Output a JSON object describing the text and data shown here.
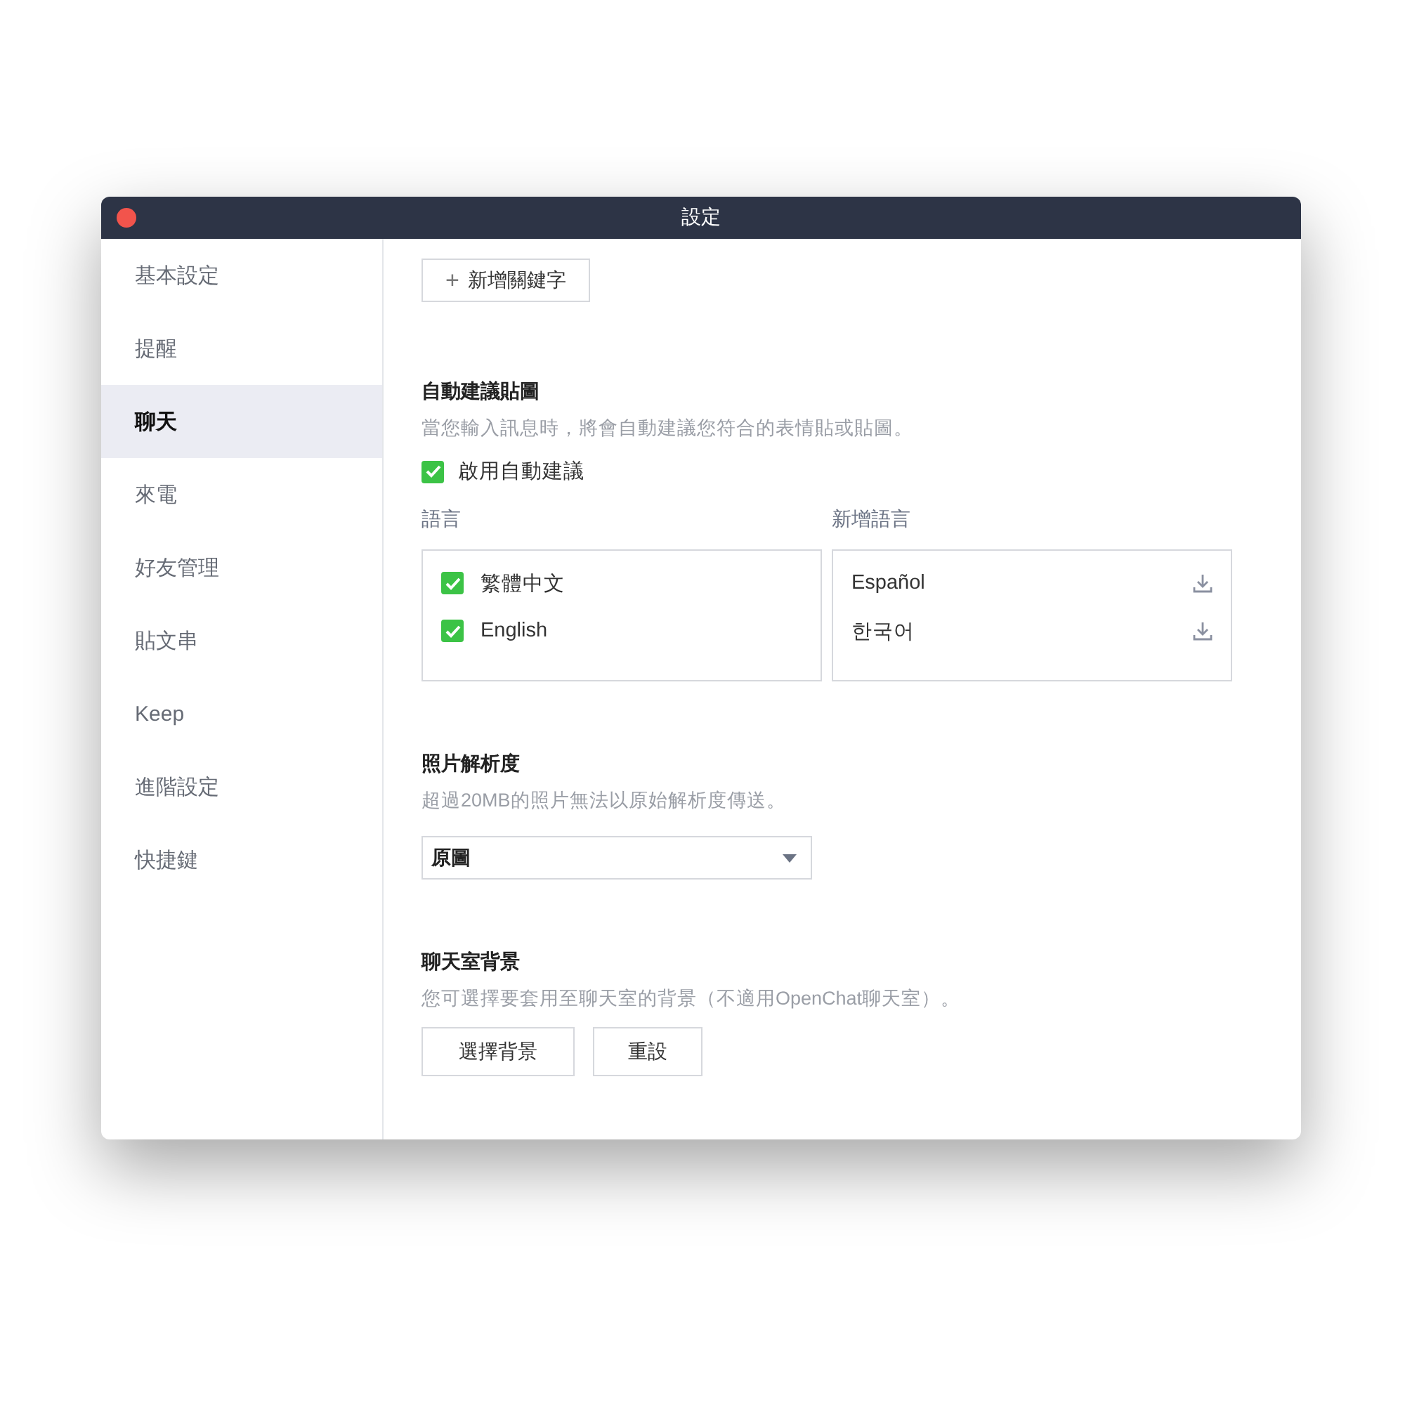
{
  "window": {
    "title": "設定"
  },
  "sidebar": {
    "items": [
      {
        "label": "基本設定",
        "selected": false
      },
      {
        "label": "提醒",
        "selected": false
      },
      {
        "label": "聊天",
        "selected": true
      },
      {
        "label": "來電",
        "selected": false
      },
      {
        "label": "好友管理",
        "selected": false
      },
      {
        "label": "貼文串",
        "selected": false
      },
      {
        "label": "Keep",
        "selected": false
      },
      {
        "label": "進階設定",
        "selected": false
      },
      {
        "label": "快捷鍵",
        "selected": false
      }
    ]
  },
  "add_keyword_button": {
    "icon": "+",
    "label": "新增關鍵字"
  },
  "sticker_suggestions": {
    "title": "自動建議貼圖",
    "description": "當您輸入訊息時，將會自動建議您符合的表情貼或貼圖。",
    "enable": {
      "label": "啟用自動建議",
      "checked": true
    },
    "languages_label": "語言",
    "languages": [
      {
        "label": "繁體中文",
        "checked": true
      },
      {
        "label": "English",
        "checked": true
      }
    ],
    "add_languages_label": "新增語言",
    "add_languages": [
      {
        "label": "Español"
      },
      {
        "label": "한국어"
      }
    ]
  },
  "photo_resolution": {
    "title": "照片解析度",
    "description": "超過20MB的照片無法以原始解析度傳送。",
    "value": "原圖"
  },
  "chat_background": {
    "title": "聊天室背景",
    "description": "您可選擇要套用至聊天室的背景（不適用OpenChat聊天室）。",
    "buttons": [
      "選擇背景",
      "重設"
    ]
  }
}
